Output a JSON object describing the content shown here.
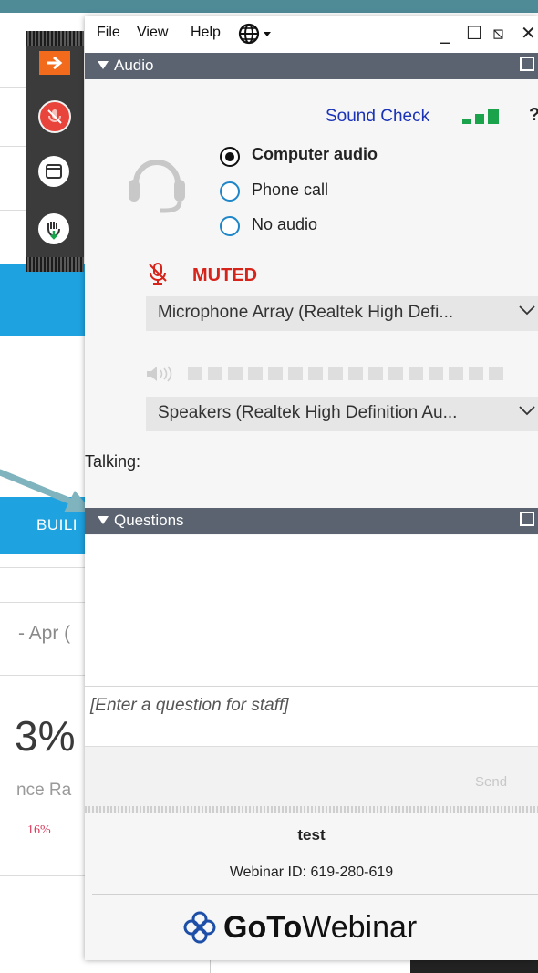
{
  "background": {
    "build_label": "BUILI",
    "date_fragment": "- Apr (",
    "percent_fragment": "3%",
    "rate_fragment": "nce Ra",
    "change_fragment": "16%"
  },
  "toolbar": {
    "icons": [
      "arrow-right-icon",
      "mic-muted-icon",
      "window-icon",
      "raise-hand-icon"
    ]
  },
  "menubar": {
    "items": [
      "File",
      "View",
      "Help"
    ],
    "language_icon": "globe-icon",
    "window_controls": [
      "_",
      "☐",
      "⧅",
      "✕"
    ]
  },
  "audio_panel": {
    "title": "Audio",
    "sound_check": "Sound Check",
    "help": "?",
    "options": [
      {
        "label": "Computer audio",
        "selected": true
      },
      {
        "label": "Phone call",
        "selected": false
      },
      {
        "label": "No audio",
        "selected": false
      }
    ],
    "muted_label": "MUTED",
    "microphone": "Microphone Array (Realtek High Defi...",
    "speakers": "Speakers (Realtek High Definition Au...",
    "talking_label": "Talking:"
  },
  "questions_panel": {
    "title": "Questions",
    "input_placeholder": "[Enter a question for staff]",
    "send_label": "Send"
  },
  "footer": {
    "webinar_title": "test",
    "webinar_id": "Webinar ID: 619-280-619",
    "brand_goto": "GoTo",
    "brand_webinar": "Webinar"
  },
  "colors": {
    "panel_header": "#5b6371",
    "accent_blue": "#1a33b8",
    "muted_red": "#d6241b",
    "signal_green": "#1aa34a"
  }
}
